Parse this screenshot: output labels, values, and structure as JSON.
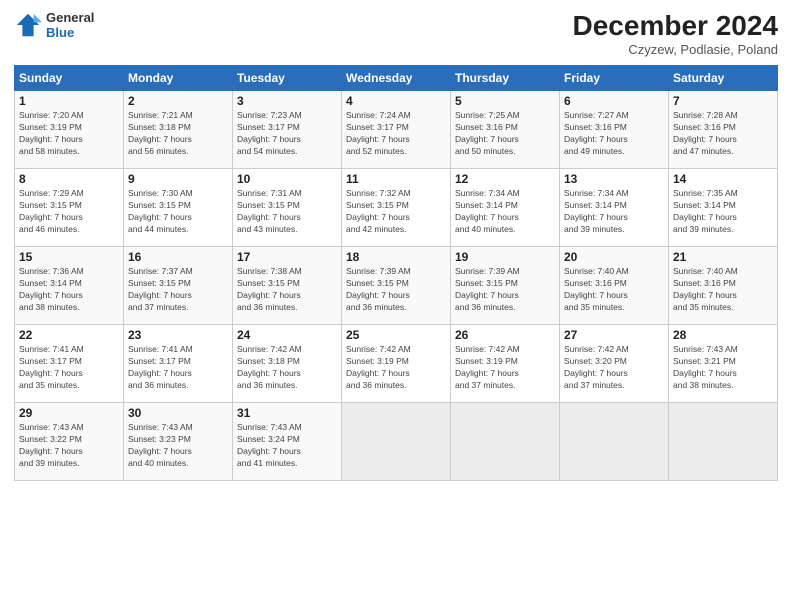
{
  "header": {
    "logo_line1": "General",
    "logo_line2": "Blue",
    "title": "December 2024",
    "subtitle": "Czyzew, Podlasie, Poland"
  },
  "days_of_week": [
    "Sunday",
    "Monday",
    "Tuesday",
    "Wednesday",
    "Thursday",
    "Friday",
    "Saturday"
  ],
  "weeks": [
    [
      {
        "day": "1",
        "detail": "Sunrise: 7:20 AM\nSunset: 3:19 PM\nDaylight: 7 hours\nand 58 minutes."
      },
      {
        "day": "2",
        "detail": "Sunrise: 7:21 AM\nSunset: 3:18 PM\nDaylight: 7 hours\nand 56 minutes."
      },
      {
        "day": "3",
        "detail": "Sunrise: 7:23 AM\nSunset: 3:17 PM\nDaylight: 7 hours\nand 54 minutes."
      },
      {
        "day": "4",
        "detail": "Sunrise: 7:24 AM\nSunset: 3:17 PM\nDaylight: 7 hours\nand 52 minutes."
      },
      {
        "day": "5",
        "detail": "Sunrise: 7:25 AM\nSunset: 3:16 PM\nDaylight: 7 hours\nand 50 minutes."
      },
      {
        "day": "6",
        "detail": "Sunrise: 7:27 AM\nSunset: 3:16 PM\nDaylight: 7 hours\nand 49 minutes."
      },
      {
        "day": "7",
        "detail": "Sunrise: 7:28 AM\nSunset: 3:16 PM\nDaylight: 7 hours\nand 47 minutes."
      }
    ],
    [
      {
        "day": "8",
        "detail": "Sunrise: 7:29 AM\nSunset: 3:15 PM\nDaylight: 7 hours\nand 46 minutes."
      },
      {
        "day": "9",
        "detail": "Sunrise: 7:30 AM\nSunset: 3:15 PM\nDaylight: 7 hours\nand 44 minutes."
      },
      {
        "day": "10",
        "detail": "Sunrise: 7:31 AM\nSunset: 3:15 PM\nDaylight: 7 hours\nand 43 minutes."
      },
      {
        "day": "11",
        "detail": "Sunrise: 7:32 AM\nSunset: 3:15 PM\nDaylight: 7 hours\nand 42 minutes."
      },
      {
        "day": "12",
        "detail": "Sunrise: 7:34 AM\nSunset: 3:14 PM\nDaylight: 7 hours\nand 40 minutes."
      },
      {
        "day": "13",
        "detail": "Sunrise: 7:34 AM\nSunset: 3:14 PM\nDaylight: 7 hours\nand 39 minutes."
      },
      {
        "day": "14",
        "detail": "Sunrise: 7:35 AM\nSunset: 3:14 PM\nDaylight: 7 hours\nand 39 minutes."
      }
    ],
    [
      {
        "day": "15",
        "detail": "Sunrise: 7:36 AM\nSunset: 3:14 PM\nDaylight: 7 hours\nand 38 minutes."
      },
      {
        "day": "16",
        "detail": "Sunrise: 7:37 AM\nSunset: 3:15 PM\nDaylight: 7 hours\nand 37 minutes."
      },
      {
        "day": "17",
        "detail": "Sunrise: 7:38 AM\nSunset: 3:15 PM\nDaylight: 7 hours\nand 36 minutes."
      },
      {
        "day": "18",
        "detail": "Sunrise: 7:39 AM\nSunset: 3:15 PM\nDaylight: 7 hours\nand 36 minutes."
      },
      {
        "day": "19",
        "detail": "Sunrise: 7:39 AM\nSunset: 3:15 PM\nDaylight: 7 hours\nand 36 minutes."
      },
      {
        "day": "20",
        "detail": "Sunrise: 7:40 AM\nSunset: 3:16 PM\nDaylight: 7 hours\nand 35 minutes."
      },
      {
        "day": "21",
        "detail": "Sunrise: 7:40 AM\nSunset: 3:16 PM\nDaylight: 7 hours\nand 35 minutes."
      }
    ],
    [
      {
        "day": "22",
        "detail": "Sunrise: 7:41 AM\nSunset: 3:17 PM\nDaylight: 7 hours\nand 35 minutes."
      },
      {
        "day": "23",
        "detail": "Sunrise: 7:41 AM\nSunset: 3:17 PM\nDaylight: 7 hours\nand 36 minutes."
      },
      {
        "day": "24",
        "detail": "Sunrise: 7:42 AM\nSunset: 3:18 PM\nDaylight: 7 hours\nand 36 minutes."
      },
      {
        "day": "25",
        "detail": "Sunrise: 7:42 AM\nSunset: 3:19 PM\nDaylight: 7 hours\nand 36 minutes."
      },
      {
        "day": "26",
        "detail": "Sunrise: 7:42 AM\nSunset: 3:19 PM\nDaylight: 7 hours\nand 37 minutes."
      },
      {
        "day": "27",
        "detail": "Sunrise: 7:42 AM\nSunset: 3:20 PM\nDaylight: 7 hours\nand 37 minutes."
      },
      {
        "day": "28",
        "detail": "Sunrise: 7:43 AM\nSunset: 3:21 PM\nDaylight: 7 hours\nand 38 minutes."
      }
    ],
    [
      {
        "day": "29",
        "detail": "Sunrise: 7:43 AM\nSunset: 3:22 PM\nDaylight: 7 hours\nand 39 minutes."
      },
      {
        "day": "30",
        "detail": "Sunrise: 7:43 AM\nSunset: 3:23 PM\nDaylight: 7 hours\nand 40 minutes."
      },
      {
        "day": "31",
        "detail": "Sunrise: 7:43 AM\nSunset: 3:24 PM\nDaylight: 7 hours\nand 41 minutes."
      },
      {
        "day": "",
        "detail": ""
      },
      {
        "day": "",
        "detail": ""
      },
      {
        "day": "",
        "detail": ""
      },
      {
        "day": "",
        "detail": ""
      }
    ]
  ]
}
